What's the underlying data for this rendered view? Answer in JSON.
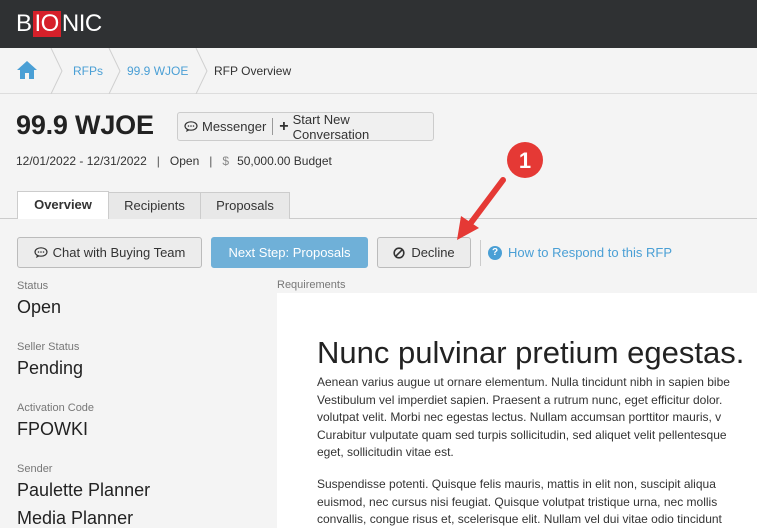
{
  "app": {
    "logo_prefix": "B",
    "logo_highlight": "IO",
    "logo_suffix": "NIC"
  },
  "breadcrumb": {
    "items": [
      {
        "label": "RFPs"
      },
      {
        "label": "99.9 WJOE"
      },
      {
        "label": "RFP Overview"
      }
    ]
  },
  "header": {
    "title": "99.9 WJOE",
    "messenger_label": "Messenger",
    "start_conversation_label": "Start New Conversation",
    "dates": "12/01/2022 - 12/31/2022",
    "status": "Open",
    "currency_symbol": "$",
    "budget": "50,000.00 Budget"
  },
  "tabs": [
    {
      "label": "Overview",
      "active": true
    },
    {
      "label": "Recipients",
      "active": false
    },
    {
      "label": "Proposals",
      "active": false
    }
  ],
  "actions": {
    "chat_label": "Chat with Buying Team",
    "next_step_label": "Next Step: Proposals",
    "decline_label": "Decline",
    "help_label": "How to Respond to this RFP"
  },
  "details": {
    "status_label": "Status",
    "status_value": "Open",
    "seller_status_label": "Seller Status",
    "seller_status_value": "Pending",
    "activation_code_label": "Activation Code",
    "activation_code_value": "FPOWKI",
    "sender_label": "Sender",
    "sender_name": "Paulette Planner",
    "sender_role": "Media Planner"
  },
  "requirements": {
    "label": "Requirements",
    "heading": "Nunc pulvinar pretium egestas.",
    "paragraph1": [
      "Aenean varius augue ut ornare elementum. Nulla tincidunt nibh in sapien bibe",
      "Vestibulum vel imperdiet sapien. Praesent a rutrum nunc, eget efficitur dolor.",
      "volutpat velit. Morbi nec egestas lectus. Nullam accumsan porttitor mauris, v",
      "Curabitur vulputate quam sed turpis sollicitudin, sed aliquet velit pellentesque",
      "eget, sollicitudin vitae est."
    ],
    "paragraph2": [
      "Suspendisse potenti. Quisque felis mauris, mattis in elit non, suscipit aliqua",
      "euismod, nec cursus nisi feugiat. Quisque volutpat tristique urna, nec mollis",
      "convallis, congue risus et, scelerisque elit. Nullam vel dui vitae odio tincidunt"
    ]
  },
  "annotation": {
    "number": "1",
    "color": "#e53935"
  }
}
